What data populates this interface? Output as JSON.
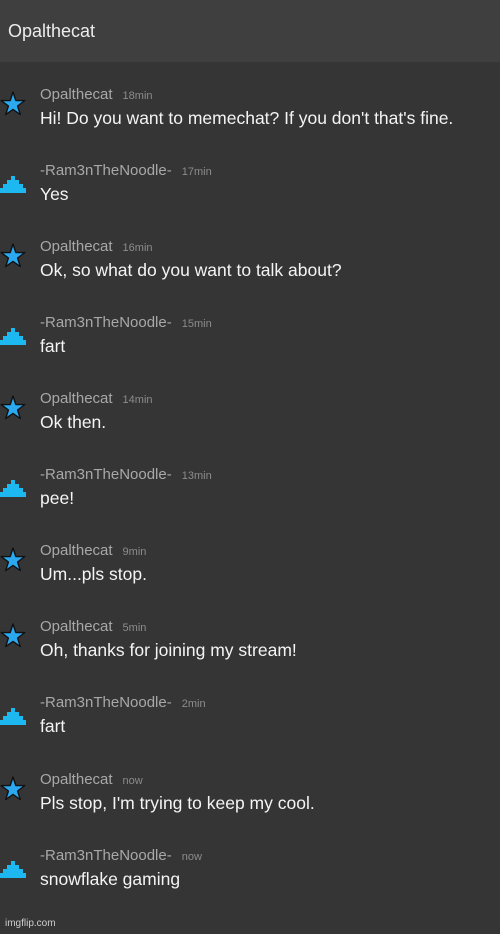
{
  "header": {
    "title": "Opalthecat"
  },
  "messages": [
    {
      "author": "Opalthecat",
      "time": "18min",
      "text": "Hi! Do you want to memechat? If you don't that's fine.",
      "avatar_icon": "star-icon"
    },
    {
      "author": "-Ram3nTheNoodle-",
      "time": "17min",
      "text": "Yes",
      "avatar_icon": "pixel-pyramid-icon"
    },
    {
      "author": "Opalthecat",
      "time": "16min",
      "text": "Ok, so what do you want to talk about?",
      "avatar_icon": "star-icon"
    },
    {
      "author": "-Ram3nTheNoodle-",
      "time": "15min",
      "text": "fart",
      "avatar_icon": "pixel-pyramid-icon"
    },
    {
      "author": "Opalthecat",
      "time": "14min",
      "text": "Ok then.",
      "avatar_icon": "star-icon"
    },
    {
      "author": "-Ram3nTheNoodle-",
      "time": "13min",
      "text": "pee!",
      "avatar_icon": "pixel-pyramid-icon"
    },
    {
      "author": "Opalthecat",
      "time": "9min",
      "text": "Um...pls stop.",
      "avatar_icon": "star-icon"
    },
    {
      "author": "Opalthecat",
      "time": "5min",
      "text": "Oh, thanks for joining my stream!",
      "avatar_icon": "star-icon"
    },
    {
      "author": "-Ram3nTheNoodle-",
      "time": "2min",
      "text": "fart",
      "avatar_icon": "pixel-pyramid-icon"
    },
    {
      "author": "Opalthecat",
      "time": "now",
      "text": "Pls stop, I'm trying to keep my cool.",
      "avatar_icon": "star-icon"
    },
    {
      "author": "-Ram3nTheNoodle-",
      "time": "now",
      "text": "snowflake gaming",
      "avatar_icon": "pixel-pyramid-icon"
    }
  ],
  "watermark": "imgflip.com",
  "colors": {
    "background": "#353535",
    "header_background": "#3f3f3f",
    "avatar_blue": "#2aa8f0",
    "pyramid_blue": "#1eb8f0"
  }
}
